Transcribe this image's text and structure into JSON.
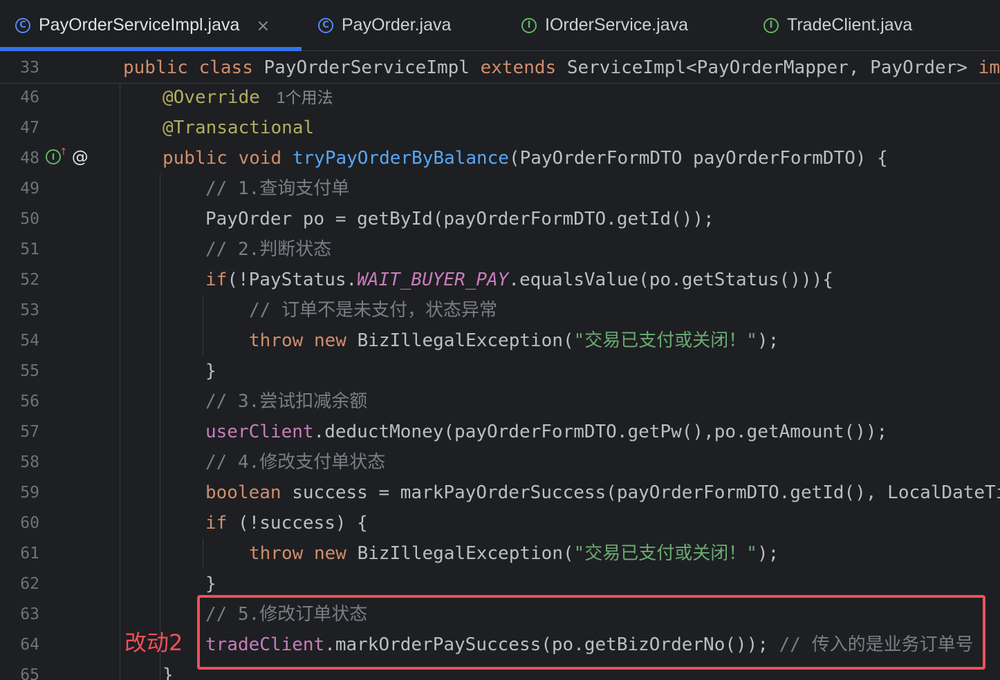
{
  "tabs": [
    {
      "label": "PayOrderServiceImpl.java",
      "icon": "C",
      "close": "×"
    },
    {
      "label": "PayOrder.java",
      "icon": "C"
    },
    {
      "label": "IOrderService.java",
      "icon": "I"
    },
    {
      "label": "TradeClient.java",
      "icon": "I"
    }
  ],
  "sticky": {
    "num": "33",
    "t1": "public",
    "t2": "class",
    "t3": "PayOrderServiceImpl",
    "t4": "extends",
    "t5": "ServiceImpl<PayOrderMapper, PayOrder>",
    "t6": "imp"
  },
  "lines": [
    {
      "num": "46",
      "t1": "@Override",
      "hint": "1个用法"
    },
    {
      "num": "47",
      "t1": "@Transactional"
    },
    {
      "num": "48",
      "t1": "public",
      "t2": "void",
      "t3": "tryPayOrderByBalance",
      "t4": "(PayOrderFormDTO payOrderFormDTO) {"
    },
    {
      "num": "49",
      "t1": "// 1.查询支付单"
    },
    {
      "num": "50",
      "t1": "PayOrder po = getById(payOrderFormDTO.getId());"
    },
    {
      "num": "51",
      "t1": "// 2.判断状态"
    },
    {
      "num": "52",
      "t1": "if",
      "t2": "(!PayStatus.",
      "t3": "WAIT_BUYER_PAY",
      "t4": ".equalsValue(po.getStatus())){"
    },
    {
      "num": "53",
      "t1": "// 订单不是未支付，状态异常"
    },
    {
      "num": "54",
      "t1": "throw",
      "t2": "new",
      "t3": "BizIllegalException(",
      "t4": "\"交易已支付或关闭！\"",
      "t5": ");"
    },
    {
      "num": "55",
      "t1": "}"
    },
    {
      "num": "56",
      "t1": "// 3.尝试扣减余额"
    },
    {
      "num": "57",
      "t1": "userClient",
      "t2": ".deductMoney(payOrderFormDTO.getPw(),po.getAmount());"
    },
    {
      "num": "58",
      "t1": "// 4.修改支付单状态"
    },
    {
      "num": "59",
      "t1": "boolean",
      "t2": "success = markPayOrderSuccess(payOrderFormDTO.getId(), LocalDateTi"
    },
    {
      "num": "60",
      "t1": "if",
      "t2": "(!success) {"
    },
    {
      "num": "61",
      "t1": "throw",
      "t2": "new",
      "t3": "BizIllegalException(",
      "t4": "\"交易已支付或关闭！\"",
      "t5": ");"
    },
    {
      "num": "62",
      "t1": "}"
    },
    {
      "num": "63",
      "t1": "// 5.修改订单状态"
    },
    {
      "num": "64",
      "t1": "tradeClient",
      "t2": ".markOrderPaySuccess(po.getBizOrderNo());",
      "t3": "// 传入的是业务订单号"
    },
    {
      "num": "65",
      "t1": "}"
    }
  ],
  "annotation": {
    "label": "改动2",
    "color": "#f0505a"
  },
  "colors": {
    "background": "#1e1f22",
    "keyword": "#cf8e6d",
    "annotation": "#b3ae60",
    "method": "#56a8f5",
    "field": "#c77dbb",
    "comment": "#7a7e85",
    "string": "#6aab73",
    "text": "#bcbec4",
    "accent": "#3574f0"
  }
}
